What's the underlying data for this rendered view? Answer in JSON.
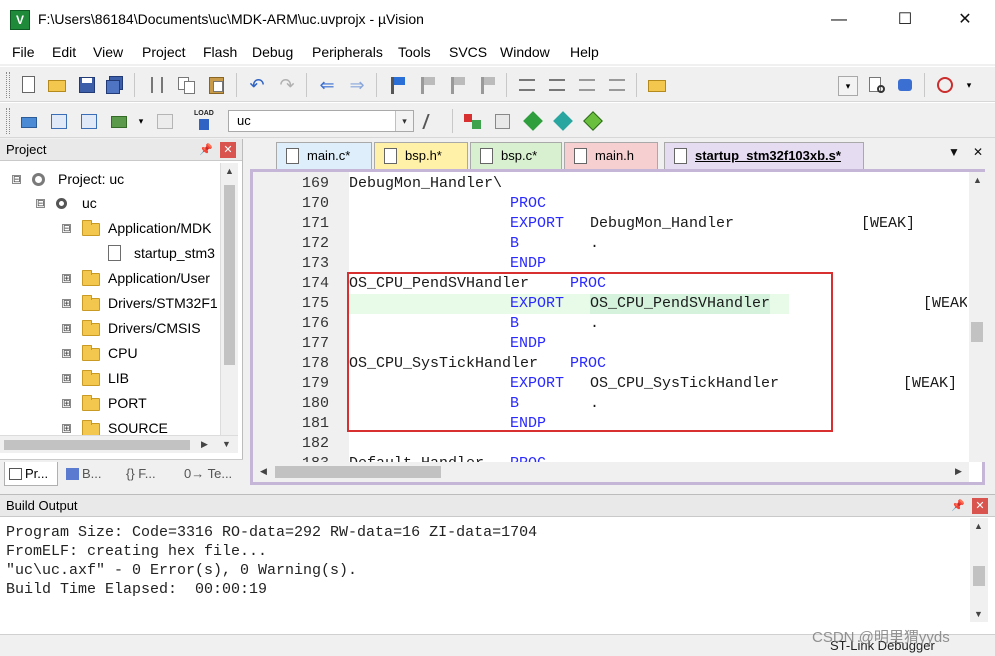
{
  "window": {
    "title": "F:\\Users\\86184\\Documents\\uc\\MDK-ARM\\uc.uvprojx - µVision",
    "minimize_glyph": "—",
    "maximize_glyph": "☐",
    "close_glyph": "✕"
  },
  "menu": [
    "File",
    "Edit",
    "View",
    "Project",
    "Flash",
    "Debug",
    "Peripherals",
    "Tools",
    "SVCS",
    "Window",
    "Help"
  ],
  "toolbar": {
    "target": "uc",
    "load_label": "LOAD",
    "dropdown_glyph": "▾"
  },
  "project_panel": {
    "title": "Project",
    "pin_glyph": "📌",
    "close_glyph": "✕",
    "tree": [
      {
        "label": "Project: uc",
        "expander": "⊟"
      },
      {
        "label": "uc",
        "expander": "⊟"
      },
      {
        "label": "Application/MDK",
        "expander": "⊟"
      },
      {
        "label": "startup_stm3",
        "expander": ""
      },
      {
        "label": "Application/User",
        "expander": "⊞"
      },
      {
        "label": "Drivers/STM32F1",
        "expander": "⊞"
      },
      {
        "label": "Drivers/CMSIS",
        "expander": "⊞"
      },
      {
        "label": "CPU",
        "expander": "⊞"
      },
      {
        "label": "LIB",
        "expander": "⊞"
      },
      {
        "label": "PORT",
        "expander": "⊞"
      },
      {
        "label": "SOURCE",
        "expander": "⊞"
      }
    ],
    "tabs": [
      "Pr...",
      "B...",
      "{} F...",
      "0→ Te..."
    ]
  },
  "editor": {
    "tabs": [
      {
        "label": "main.c*",
        "color": "#dfeefb"
      },
      {
        "label": "bsp.h*",
        "color": "#fff2a8"
      },
      {
        "label": "bsp.c*",
        "color": "#d8f0d0"
      },
      {
        "label": "main.h",
        "color": "#f6cfd0"
      },
      {
        "label": "startup_stm32f103xb.s*",
        "color": "#e6dcf2"
      }
    ],
    "menu_glyph": "▼",
    "close_glyph": "✕",
    "lines": [
      {
        "num": "169",
        "label": "DebugMon_Handler\\",
        "op": "",
        "arg": "",
        "attr": ""
      },
      {
        "num": "170",
        "label": "",
        "op": "PROC",
        "arg": "",
        "attr": ""
      },
      {
        "num": "171",
        "label": "",
        "op": "EXPORT",
        "arg": "DebugMon_Handler",
        "attr": "[WEAK]"
      },
      {
        "num": "172",
        "label": "",
        "op": "B",
        "arg": ".",
        "attr": ""
      },
      {
        "num": "173",
        "label": "",
        "op": "ENDP",
        "arg": "",
        "attr": ""
      },
      {
        "num": "174",
        "label": "OS_CPU_PendSVHandler",
        "op": "PROC",
        "arg": "",
        "attr": ""
      },
      {
        "num": "175",
        "label": "",
        "op": "EXPORT",
        "arg": "OS_CPU_PendSVHandler",
        "attr": "[WEAK"
      },
      {
        "num": "176",
        "label": "",
        "op": "B",
        "arg": ".",
        "attr": ""
      },
      {
        "num": "177",
        "label": "",
        "op": "ENDP",
        "arg": "",
        "attr": ""
      },
      {
        "num": "178",
        "label": "OS_CPU_SysTickHandler",
        "op": "PROC",
        "arg": "",
        "attr": ""
      },
      {
        "num": "179",
        "label": "",
        "op": "EXPORT",
        "arg": "OS_CPU_SysTickHandler",
        "attr": "[WEAK]"
      },
      {
        "num": "180",
        "label": "",
        "op": "B",
        "arg": ".",
        "attr": ""
      },
      {
        "num": "181",
        "label": "",
        "op": "ENDP",
        "arg": "",
        "attr": ""
      },
      {
        "num": "182",
        "label": "",
        "op": "",
        "arg": "",
        "attr": ""
      },
      {
        "num": "183",
        "label": "Default_Handler",
        "op": "PROC",
        "arg": "",
        "attr": ""
      }
    ],
    "keyword_color": "#2a2aff"
  },
  "build_output": {
    "title": "Build Output",
    "pin_glyph": "📌",
    "close_glyph": "✕",
    "lines": [
      "Program Size: Code=3316 RO-data=292 RW-data=16 ZI-data=1704",
      "FromELF: creating hex file...",
      "\"uc\\uc.axf\" - 0 Error(s), 0 Warning(s).",
      "Build Time Elapsed:  00:00:19"
    ]
  },
  "status": {
    "debugger": "ST-Link Debugger",
    "watermark": "CSDN @明里猬yyds"
  }
}
